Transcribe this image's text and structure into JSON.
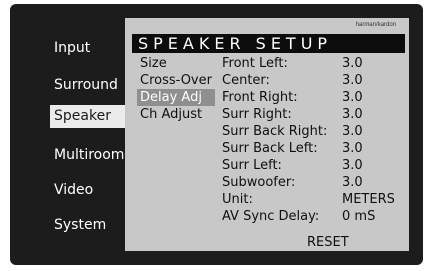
{
  "brand": "harman/kardon",
  "main_menu": {
    "items": [
      {
        "label": "Input"
      },
      {
        "label": "Surround"
      },
      {
        "label": "Speaker"
      },
      {
        "label": "Multiroom"
      },
      {
        "label": "Video"
      },
      {
        "label": "System"
      }
    ],
    "selected": "Speaker"
  },
  "panel": {
    "title": "SPEAKER SETUP",
    "submenu": [
      {
        "label": "Size"
      },
      {
        "label": "Cross-Over"
      },
      {
        "label": "Delay Adj"
      },
      {
        "label": "Ch Adjust"
      }
    ],
    "selected_submenu": "Delay Adj",
    "settings": [
      {
        "label": "Front Left:",
        "value": "3.0"
      },
      {
        "label": "Center:",
        "value": "3.0"
      },
      {
        "label": "Front Right:",
        "value": "3.0"
      },
      {
        "label": "Surr Right:",
        "value": "3.0"
      },
      {
        "label": "Surr Back Right:",
        "value": "3.0"
      },
      {
        "label": "Surr Back Left:",
        "value": "3.0"
      },
      {
        "label": "Surr Left:",
        "value": "3.0"
      },
      {
        "label": "Subwoofer:",
        "value": "3.0"
      },
      {
        "label": "Unit:",
        "value": "METERS"
      },
      {
        "label": "AV Sync Delay:",
        "value": "0 mS"
      }
    ],
    "reset_label": "RESET"
  }
}
